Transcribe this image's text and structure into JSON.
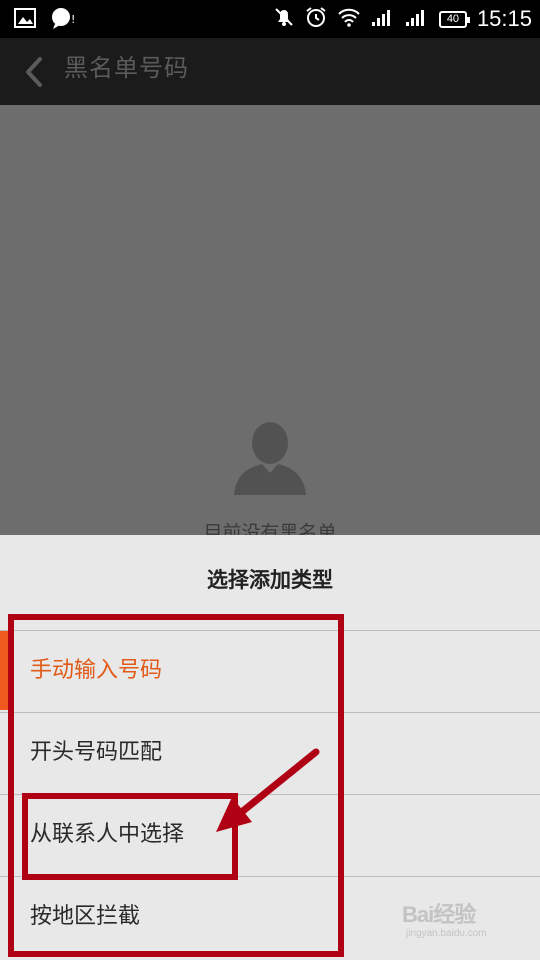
{
  "status_bar": {
    "time": "15:15",
    "battery": "40",
    "icons": [
      "image-icon",
      "chat-icon",
      "mute-icon",
      "alarm-icon",
      "wifi-icon",
      "signal-icon",
      "signal-icon",
      "battery-icon"
    ]
  },
  "header": {
    "title": "黑名单号码",
    "back_icon": "back-arrow-icon"
  },
  "empty_state": {
    "text": "目前没有黑名单",
    "icon": "person-silhouette-icon"
  },
  "sheet": {
    "title": "选择添加类型",
    "options": [
      {
        "label": "手动输入号码",
        "selected": true
      },
      {
        "label": "开头号码匹配",
        "selected": false
      },
      {
        "label": "从联系人中选择",
        "selected": false
      },
      {
        "label": "按地区拦截",
        "selected": false
      }
    ]
  },
  "colors": {
    "accent_orange": "#e15a18",
    "annotation_red": "#b00014"
  },
  "watermark": {
    "brand": "Bai经验",
    "url": "jingyan.baidu.com"
  }
}
